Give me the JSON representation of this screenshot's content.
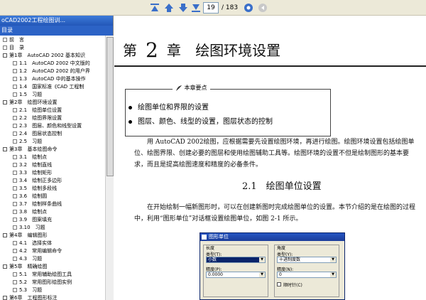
{
  "toolbar": {
    "current_page": "19",
    "total_pages": "/ 183",
    "buttons": [
      "first-page",
      "previous-page",
      "next-page",
      "last-page",
      "go",
      "back"
    ]
  },
  "panel": {
    "title": "oCAD2002工程绘图训...",
    "header": "目录"
  },
  "tree": [
    {
      "label": "前　言",
      "level": 0
    },
    {
      "label": "目　录",
      "level": 0
    },
    {
      "label": "第1章　AutoCAD 2002 基本知识",
      "level": 0,
      "expand": true
    },
    {
      "label": "1.1　AutoCAD 2002 中文版的",
      "level": 1
    },
    {
      "label": "1.2　AutoCAD 2002 的用户界",
      "level": 1
    },
    {
      "label": "1.3　AutoCAD 中的基本操作",
      "level": 1
    },
    {
      "label": "1.4　国家标准《CAD 工程制",
      "level": 1
    },
    {
      "label": "1.5　习题",
      "level": 1
    },
    {
      "label": "第2章　绘图环境设置",
      "level": 0,
      "expand": true
    },
    {
      "label": "2.1　绘图单位设置",
      "level": 1
    },
    {
      "label": "2.2　绘图界限设置",
      "level": 1
    },
    {
      "label": "2.3　图层、颜色和线型设置",
      "level": 1
    },
    {
      "label": "2.4　图层状态控制",
      "level": 1
    },
    {
      "label": "2.5　习题",
      "level": 1
    },
    {
      "label": "第3章　基本绘图命令",
      "level": 0,
      "expand": true
    },
    {
      "label": "3.1　绘制点",
      "level": 1
    },
    {
      "label": "3.2　绘制直线",
      "level": 1
    },
    {
      "label": "3.3　绘制矩形",
      "level": 1
    },
    {
      "label": "3.4　绘制正多边形",
      "level": 1
    },
    {
      "label": "3.5　绘制多段线",
      "level": 1
    },
    {
      "label": "3.6　绘制圆",
      "level": 1
    },
    {
      "label": "3.7　绘制样条曲线",
      "level": 1
    },
    {
      "label": "3.8　绘制点",
      "level": 1
    },
    {
      "label": "3.9　图案填充",
      "level": 1
    },
    {
      "label": "3.10　习题",
      "level": 1
    },
    {
      "label": "第4章　编辑图形",
      "level": 0,
      "expand": true
    },
    {
      "label": "4.1　选择实体",
      "level": 1
    },
    {
      "label": "4.2　常用编辑命令",
      "level": 1
    },
    {
      "label": "4.3　习题",
      "level": 1
    },
    {
      "label": "第5章　精确绘图",
      "level": 0,
      "expand": true
    },
    {
      "label": "5.1　常用辅助绘图工具",
      "level": 1
    },
    {
      "label": "5.2　常用图形绘图实例",
      "level": 1
    },
    {
      "label": "5.3　习题",
      "level": 1
    },
    {
      "label": "第6章　工程图形标注",
      "level": 0,
      "expand": true
    }
  ],
  "doc": {
    "chapter_prefix": "第",
    "chapter_number": "2",
    "chapter_suffix": "章",
    "chapter_title": "绘图环境设置",
    "key_points_label": "本章要点",
    "key_points": [
      "绘图单位和界限的设置",
      "图层、颜色、线型的设置，图层状态的控制"
    ],
    "intro_paragraph": "用 AutoCAD 2002绘图，应根据需要先设置绘图环境，再进行绘图。绘图环境设置包括绘图单位、绘图界限、创建必要的图层和使用绘图辅助工具等。绘图环境的设置不但是绘制图形的基本要求，而且是提高绘图速度和精度的必备条件。",
    "section_title": "2.1　绘图单位设置",
    "section_paragraph": "在开始绘制一幅新图形时，可以在创建新图时完成绘图单位的设置。本节介绍的是在绘图的过程中，利用“图形单位”对话框设置绘图单位，如图 2-1 所示。"
  },
  "dialog": {
    "title": "图形单位",
    "length_group": "长度",
    "type_label": "类型(T):",
    "type_value": "小数",
    "precision_label": "精度(P):",
    "precision_value": "0.0000",
    "angle_group": "角度",
    "angle_type_label": "类型(Y):",
    "angle_type_value": "十进制度数",
    "angle_precision_label": "精度(N):",
    "angle_precision_value": "0",
    "clockwise_label": "顺时针(C)"
  },
  "colors": {
    "toolbar_bg": "#ece9d8",
    "panel_title": "#2c63c6",
    "toolbar_icon": "#3a6fc9"
  }
}
